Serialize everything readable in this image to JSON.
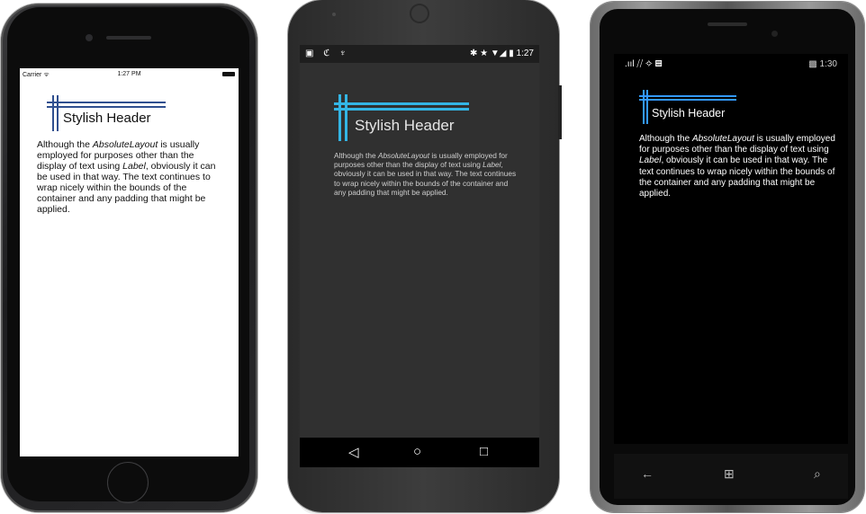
{
  "header_text": "Stylish Header",
  "paragraph": {
    "before_layout": "Although the ",
    "layout_class": "AbsoluteLayout",
    "middle": " is usually employed for purposes other than the display of text using ",
    "label_class": "Label",
    "after": ", obviously it can be used in that way. The text continues to wrap nicely within the bounds of the container and any padding that might be applied."
  },
  "ios": {
    "carrier": "Carrier ᯤ",
    "time": "1:27 PM",
    "header_color": "#2f4f8f",
    "text_color": "#111111"
  },
  "android": {
    "status_left": "▣ ℭ ♆",
    "status_right": "✱ ★ ▼◢ ▮ 1:27",
    "nav_back": "◁",
    "nav_home": "○",
    "nav_recent": "□",
    "header_color": "#33b5e5"
  },
  "windows": {
    "status_left": ".ııl ⧸⧸ ✧ ▤",
    "status_right": "▩ 1:30",
    "nav_back": "←",
    "nav_start": "⊞",
    "nav_search": "⌕",
    "header_color": "#3399ff"
  }
}
